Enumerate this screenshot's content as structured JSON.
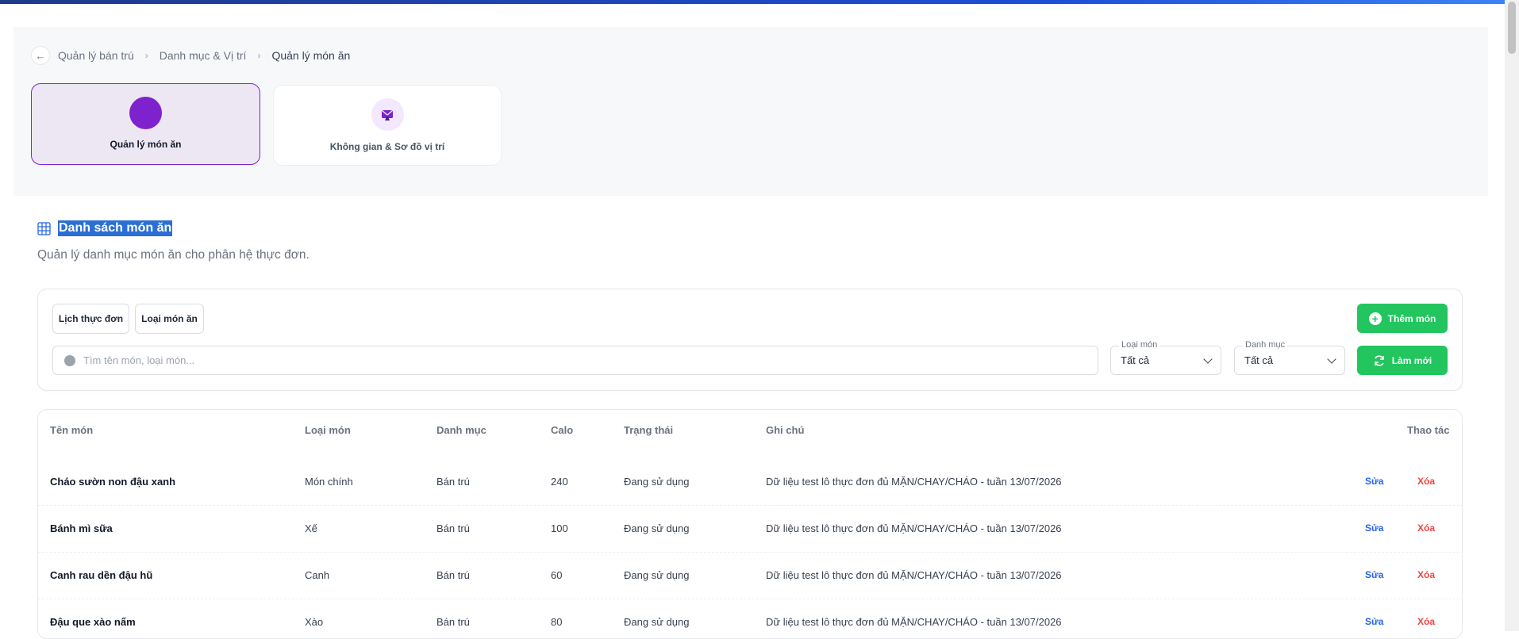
{
  "breadcrumb": {
    "back_icon": "arrow-left-icon",
    "items": [
      "Quản lý bán trú",
      "Danh mục & Vị trí",
      "Quản lý món ăn"
    ]
  },
  "nav_cards": [
    {
      "label": "Quản lý món ăn",
      "active": true
    },
    {
      "label": "Không gian & Sơ đồ vị trí",
      "active": false
    }
  ],
  "section": {
    "title": "Danh sách món ăn",
    "subtitle": "Quản lý danh mục món ăn cho phân hệ thực đơn."
  },
  "filters": {
    "chip_menu_schedule": "Lịch thực đơn",
    "chip_dish_types": "Loại món ăn",
    "add_button": "Thêm món",
    "search_placeholder": "Tìm tên món, loại món...",
    "dish_type_label": "Loại món",
    "dish_type_value": "Tất cả",
    "category_label": "Danh mục",
    "category_value": "Tất cả",
    "refresh_button": "Làm mới"
  },
  "table": {
    "headers": {
      "name": "Tên món",
      "type": "Loại món",
      "category": "Danh mục",
      "calo": "Calo",
      "status": "Trạng thái",
      "note": "Ghi chú",
      "actions": "Thao tác"
    },
    "edit_label": "Sửa",
    "delete_label": "Xóa",
    "rows": [
      {
        "name": "Cháo sườn non đậu xanh",
        "type": "Món chính",
        "category": "Bán trú",
        "calo": "240",
        "status": "Đang sử dụng",
        "note": "Dữ liệu test lô thực đơn đủ MẶN/CHAY/CHÁO - tuần 13/07/2026"
      },
      {
        "name": "Bánh mì sữa",
        "type": "Xế",
        "category": "Bán trú",
        "calo": "100",
        "status": "Đang sử dụng",
        "note": "Dữ liệu test lô thực đơn đủ MẶN/CHAY/CHÁO - tuần 13/07/2026"
      },
      {
        "name": "Canh rau dền đậu hũ",
        "type": "Canh",
        "category": "Bán trú",
        "calo": "60",
        "status": "Đang sử dụng",
        "note": "Dữ liệu test lô thực đơn đủ MẶN/CHAY/CHÁO - tuần 13/07/2026"
      },
      {
        "name": "Đậu que xào nấm",
        "type": "Xào",
        "category": "Bán trú",
        "calo": "80",
        "status": "Đang sử dụng",
        "note": "Dữ liệu test lô thực đơn đủ MẶN/CHAY/CHÁO - tuần 13/07/2026"
      }
    ]
  },
  "colors": {
    "accent_purple": "#7e22ce",
    "green": "#22c55e",
    "edit_blue": "#2563eb",
    "delete_red": "#ef4444"
  }
}
